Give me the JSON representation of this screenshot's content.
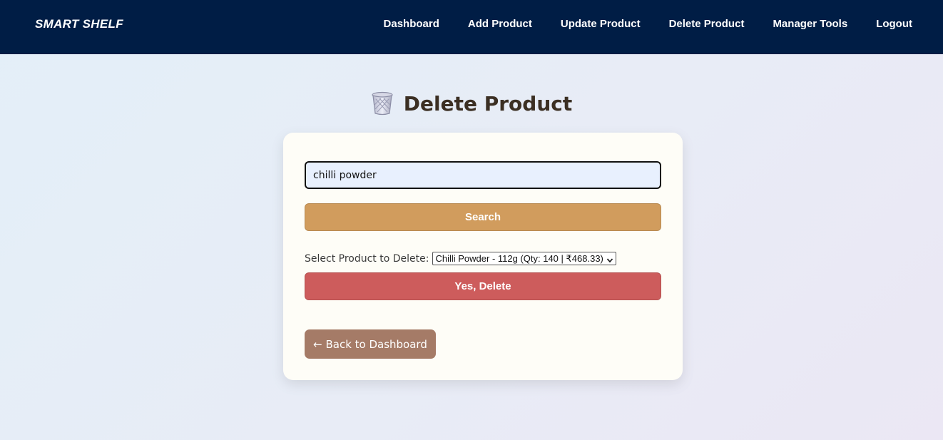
{
  "brand": "SMART SHELF",
  "nav": {
    "items": [
      {
        "label": "Dashboard"
      },
      {
        "label": "Add Product"
      },
      {
        "label": "Update Product"
      },
      {
        "label": "Delete Product"
      },
      {
        "label": "Manager Tools"
      },
      {
        "label": "Logout"
      }
    ]
  },
  "page": {
    "title": "Delete Product",
    "icon": "wastebasket-icon"
  },
  "form": {
    "search_value": "chilli powder",
    "search_button": "Search",
    "select_label": "Select Product to Delete:",
    "selected_option": "Chilli Powder - 112g (Qty: 140 | ₹468.33)",
    "delete_button": "Yes, Delete",
    "back_button": "← Back to Dashboard"
  },
  "colors": {
    "navbar": "#001d45",
    "search_button": "#d19c5d",
    "delete_button": "#cd5c5c",
    "back_button": "#a57b67",
    "card": "#fefdf7"
  }
}
